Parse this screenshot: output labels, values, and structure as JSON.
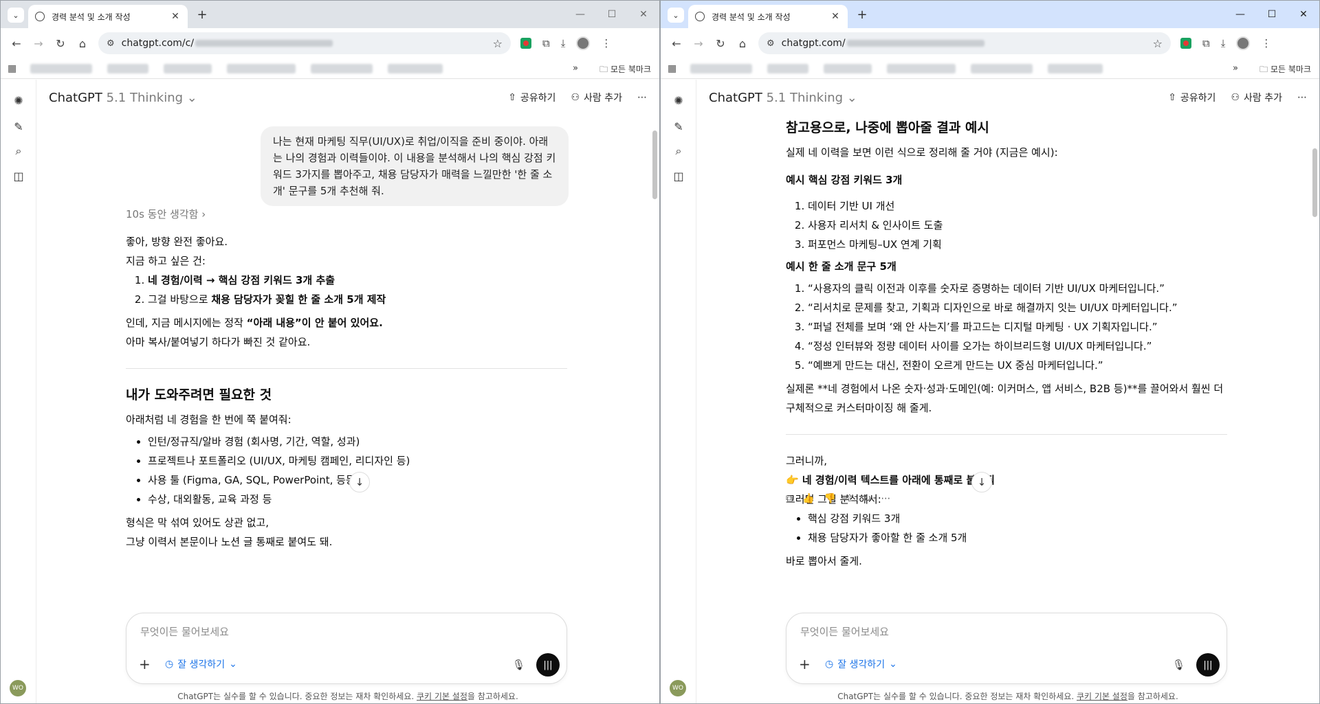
{
  "windows": [
    {
      "tab_title": "경력 분석 및 소개 작성",
      "url": "chatgpt.com/c/",
      "all_bookmarks": "모든 북마크",
      "model_name": "ChatGPT",
      "model_ver": "5.1 Thinking",
      "share": "공유하기",
      "add_person": "사람 추가",
      "user_message": "나는 현재 마케팅 직무(UI/UX)로 취업/이직을 준비 중이야. 아래는 나의 경험과 이력들이야. 이 내용을 분석해서 나의 핵심 강점 키워드 3가지를 뽑아주고, 채용 담당자가 매력을 느낄만한 '한 줄 소개' 문구를 5개 추천해 줘.",
      "thinking": "10s 동안 생각함 ›",
      "p1": "좋아, 방향 완전 좋아요.",
      "p2": "지금 하고 싶은 건:",
      "ol": [
        "네 경험/이력 → 핵심 강점 키워드 3개 추출",
        "그걸 바탕으로 채용 담당자가 꽂힐 한 줄 소개 5개 제작"
      ],
      "ol2_prefix": "그걸 바탕으로 ",
      "ol2_bold": "채용 담당자가 꽂힐 한 줄 소개 5개 제작",
      "p3a": "인데, 지금 메시지에는 정작 ",
      "p3b": "“아래 내용”이 안 붙어 있어요.",
      "p4": "아마 복사/붙여넣기 하다가 빠진 것 같아요.",
      "h_need": "내가 도와주려면 필요한 것",
      "p5": "아래처럼 네 경험을 한 번에 쭉 붙여줘:",
      "ul": [
        "인턴/정규직/알바 경험 (회사명, 기간, 역할, 성과)",
        "프로젝트나 포트폴리오 (UI/UX, 마케팅 캠페인, 리디자인 등)",
        "사용 툴 (Figma, GA, SQL, PowerPoint, 등등)",
        "수상, 대외활동, 교육 과정 등"
      ],
      "p6": "형식은 막 섞여 있어도 상관 없고,",
      "p7": "그냥 이력서 본문이나 노션 글 통째로 붙여도 돼.",
      "placeholder": "무엇이든 물어보세요",
      "think_mode": "잘 생각하기",
      "footer_a": "ChatGPT는 실수를 할 수 있습니다. 중요한 정보는 재차 확인하세요. ",
      "footer_link": "쿠키 기본 설정",
      "footer_b": "을 참고하세요.",
      "avatar": "WO"
    },
    {
      "tab_title": "경력 분석 및 소개 작성",
      "url": "chatgpt.com/",
      "all_bookmarks": "모든 북마크",
      "model_name": "ChatGPT",
      "model_ver": "5.1 Thinking",
      "share": "공유하기",
      "add_person": "사람 추가",
      "h_example": "참고용으로, 나중에 뽑아줄 결과 예시",
      "p1": "실제 네 이력을 보면 이런 식으로 정리해 줄 거야 (지금은 예시):",
      "h_kw": "예시 핵심 강점 키워드 3개",
      "kw": [
        "데이터 기반 UI 개선",
        "사용자 리서치 & 인사이트 도출",
        "퍼포먼스 마케팅–UX 연계 기획"
      ],
      "h_intro": "예시 한 줄 소개 문구 5개",
      "intro": [
        "“사용자의 클릭 이전과 이후를 숫자로 증명하는 데이터 기반 UI/UX 마케터입니다.”",
        "“리서치로 문제를 찾고, 기획과 디자인으로 바로 해결까지 잇는 UI/UX 마케터입니다.”",
        "“퍼널 전체를 보며 ‘왜 안 사는지’를 파고드는 디지털 마케팅 · UX 기획자입니다.”",
        "“정성 인터뷰와 정량 데이터 사이를 오가는 하이브리드형 UI/UX 마케터입니다.”",
        "“예쁘게 만드는 대신, 전환이 오르게 만드는 UX 중심 마케터입니다.”"
      ],
      "p2": "실제론 **네 경험에서 나온 숫자·성과·도메인(예: 이커머스, 앱 서비스, B2B 등)**를 끌어와서 훨씬 더 구체적으로 커스터마이징 해 줄게.",
      "p3": "그러니까,",
      "p4": "👉 네 경험/이력 텍스트를 아래에 통째로 붙여줘",
      "p5": "그러면 그걸 분석해서:",
      "ul": [
        "핵심 강점 키워드 3개",
        "채용 담당자가 좋아할 한 줄 소개 5개"
      ],
      "p6": "바로 뽑아서 줄게.",
      "placeholder": "무엇이든 물어보세요",
      "think_mode": "잘 생각하기",
      "footer_a": "ChatGPT는 실수를 할 수 있습니다. 중요한 정보는 재차 확인하세요. ",
      "footer_link": "쿠키 기본 설정",
      "footer_b": "을 참고하세요.",
      "avatar": "WO"
    }
  ]
}
